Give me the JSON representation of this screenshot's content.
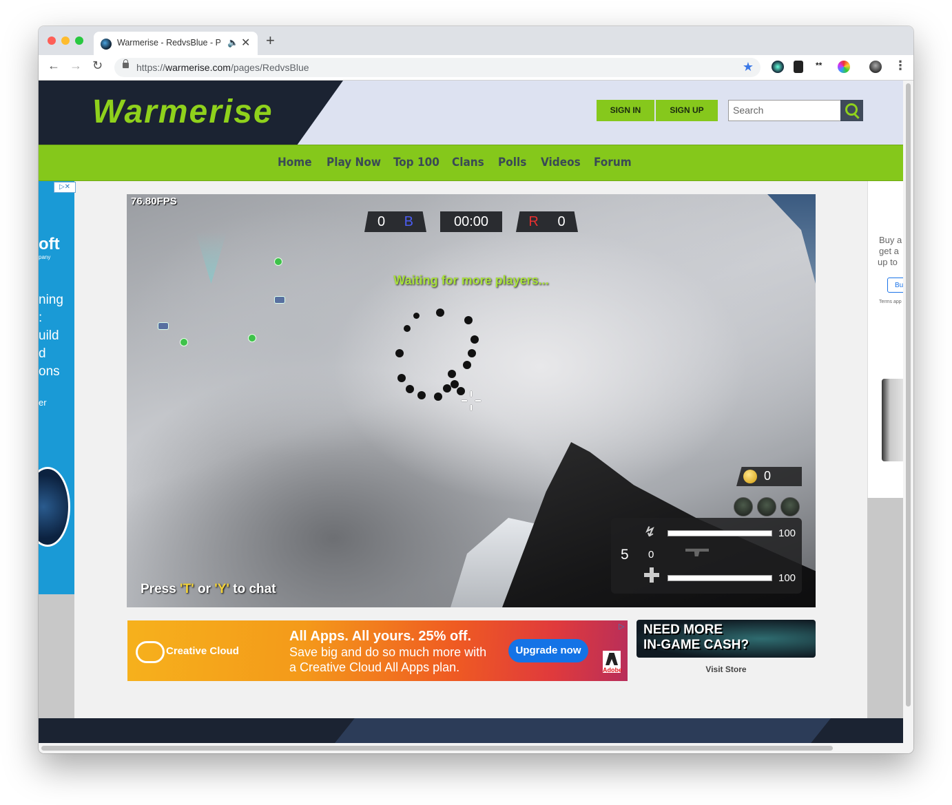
{
  "browser": {
    "tab_title": "Warmerise - RedvsBlue - P",
    "url_prefix": "https://",
    "url_host": "warmerise.com",
    "url_path": "/pages/RedvsBlue",
    "icons": [
      "back-icon",
      "forward-icon",
      "reload-icon",
      "lock-icon",
      "star-icon",
      "extension-icon",
      "menu-icon"
    ]
  },
  "site": {
    "logo": "Warmerise",
    "sign_in": "SIGN IN",
    "sign_up": "SIGN UP",
    "search_placeholder": "Search",
    "accent": "#86c81c",
    "nav": [
      "Home",
      "Play Now",
      "Top 100",
      "Clans",
      "Polls",
      "Videos",
      "Forum"
    ]
  },
  "ads": {
    "left_lines": [
      "oft",
      "pany",
      "ning",
      ":",
      "uild",
      "d",
      "ons",
      "er"
    ],
    "right_lines": [
      "Buy a",
      "get a",
      "up to",
      "Bu",
      "Terms app"
    ],
    "banner_brand": "Creative Cloud",
    "banner_headline": "All Apps. All yours. 25% off.",
    "banner_line1": "Save big and do so much more with",
    "banner_line2": "a Creative Cloud All Apps plan.",
    "banner_button": "Upgrade now",
    "banner_adobe": "Adobe",
    "store_line1": "NEED MORE",
    "store_line2": "IN-GAME CASH?",
    "visit_store": "Visit Store"
  },
  "game": {
    "fps": "76.80FPS",
    "blue_score": "0",
    "blue_letter": "B",
    "timer": "00:00",
    "red_letter": "R",
    "red_score": "0",
    "status": "Waiting for more players...",
    "chat_press": "Press ",
    "chat_t": "'T'",
    "chat_or": " or ",
    "chat_y": "'Y'",
    "chat_end": " to chat",
    "coins": "0",
    "stamina": "100",
    "health": "100",
    "ammo_mag": "5",
    "ammo_reserve": "0"
  }
}
